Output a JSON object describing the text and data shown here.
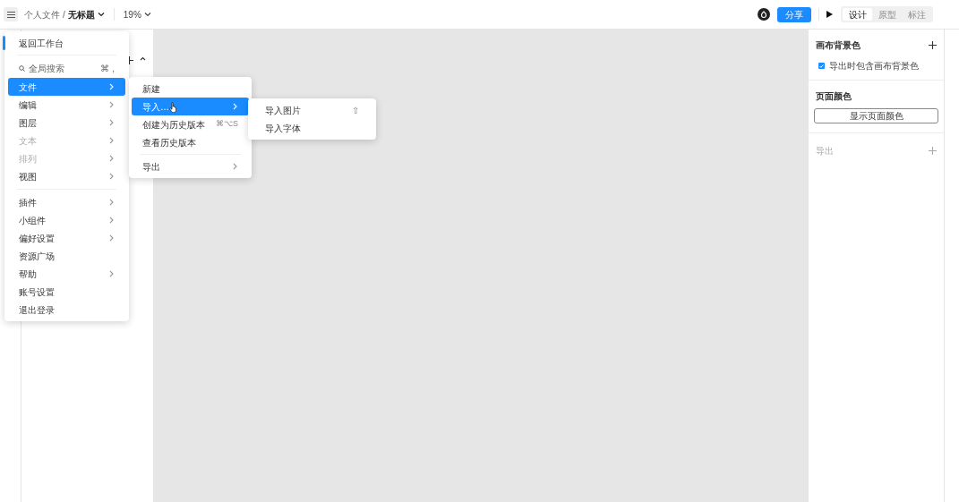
{
  "toolbar": {
    "breadcrumb_parent": "个人文件",
    "breadcrumb_separator": "/",
    "file_name": "无标题",
    "zoom": "19%",
    "share": "分享",
    "tabs": [
      {
        "label": "设计",
        "selected": true
      },
      {
        "label": "原型",
        "selected": false
      },
      {
        "label": "标注",
        "selected": false
      }
    ]
  },
  "main_menu": {
    "back": "返回工作台",
    "search": {
      "label": "全局搜索",
      "shortcut": "⌘ ,"
    },
    "groups": [
      [
        {
          "label": "文件",
          "submenu": true,
          "selected": true,
          "disabled": false
        },
        {
          "label": "编辑",
          "submenu": true,
          "selected": false,
          "disabled": false
        },
        {
          "label": "图层",
          "submenu": true,
          "selected": false,
          "disabled": false
        },
        {
          "label": "文本",
          "submenu": true,
          "selected": false,
          "disabled": true
        },
        {
          "label": "排列",
          "submenu": true,
          "selected": false,
          "disabled": true
        },
        {
          "label": "视图",
          "submenu": true,
          "selected": false,
          "disabled": false
        }
      ],
      [
        {
          "label": "插件",
          "submenu": true,
          "selected": false,
          "disabled": false
        },
        {
          "label": "小组件",
          "submenu": true,
          "selected": false,
          "disabled": false
        },
        {
          "label": "偏好设置",
          "submenu": true,
          "selected": false,
          "disabled": false
        },
        {
          "label": "资源广场",
          "submenu": false,
          "selected": false,
          "disabled": false
        },
        {
          "label": "帮助",
          "submenu": true,
          "selected": false,
          "disabled": false
        },
        {
          "label": "账号设置",
          "submenu": false,
          "selected": false,
          "disabled": false
        },
        {
          "label": "退出登录",
          "submenu": false,
          "selected": false,
          "disabled": false
        }
      ]
    ]
  },
  "file_menu": {
    "groups": [
      [
        {
          "label": "新建",
          "submenu": false,
          "selected": false
        },
        {
          "label": "导入…",
          "submenu": true,
          "selected": true
        },
        {
          "label": "创建为历史版本",
          "submenu": false,
          "selected": false,
          "shortcut": "⌘⌥S"
        },
        {
          "label": "查看历史版本",
          "submenu": false,
          "selected": false
        }
      ],
      [
        {
          "label": "导出",
          "submenu": true,
          "selected": false
        }
      ]
    ]
  },
  "import_menu": [
    {
      "label": "导入图片",
      "shortcut": "⇧"
    },
    {
      "label": "导入字体"
    }
  ],
  "right_panel": {
    "canvas_background": {
      "title": "画布背景色",
      "checkbox": {
        "label": "导出时包含画布背景色",
        "checked": true
      }
    },
    "page_color": {
      "title": "页面颜色",
      "button": "显示页面颜色"
    },
    "export": {
      "title": "导出",
      "disabled": true
    }
  }
}
